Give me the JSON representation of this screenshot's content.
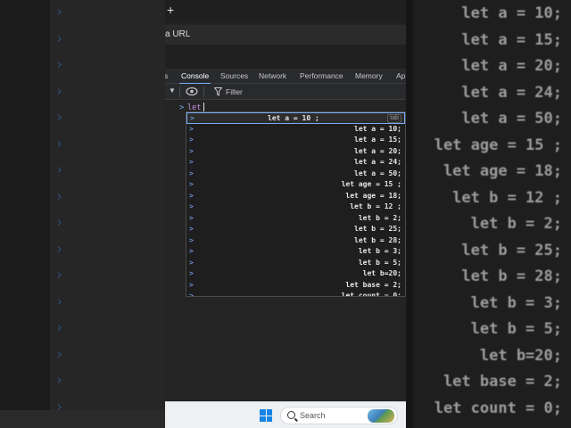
{
  "browser": {
    "new_tab": "+",
    "url_hint": "a URL"
  },
  "devtools": {
    "tabs": [
      {
        "label": "s",
        "active": false
      },
      {
        "label": "Console",
        "active": true
      },
      {
        "label": "Sources",
        "active": false
      },
      {
        "label": "Network",
        "active": false
      },
      {
        "label": "Performance",
        "active": false
      },
      {
        "label": "Memory",
        "active": false
      },
      {
        "label": "Ap",
        "active": false
      }
    ],
    "toolbar": {
      "dropdown_arrow": "▼",
      "filter_label": "Filter"
    },
    "console": {
      "prompt": ">",
      "input": "let",
      "autocomplete": {
        "tab_hint": "tab",
        "items": [
          "let a = 10 ;",
          "let a = 10;",
          "let a = 15;",
          "let a = 20;",
          "let a = 24;",
          "let a = 50;",
          "let age = 15 ;",
          "let age = 18;",
          "let b = 12 ;",
          "let b = 2;",
          "let b = 25;",
          "let b = 28;",
          "let b = 3;",
          "let b = 5;",
          "let b=20;",
          "let base = 2;",
          "let count = 0;"
        ]
      }
    }
  },
  "taskbar": {
    "search_label": "Search"
  },
  "background_right_lines": [
    "let a = 10;",
    "let a = 15;",
    "let a = 20;",
    "let a = 24;",
    "let a = 50;",
    "let age = 15 ;",
    "let age = 18;",
    "let b = 12 ;",
    "let b = 2;",
    "let b = 25;",
    "let b = 28;",
    "let b = 3;",
    "let b = 5;",
    "let b=20;",
    "let base = 2;",
    "let count = 0;"
  ],
  "colors": {
    "accent": "#7cacf8",
    "keyword": "#c792ea",
    "panel_bg": "#242424",
    "taskbar_bg": "#eef0f3"
  }
}
